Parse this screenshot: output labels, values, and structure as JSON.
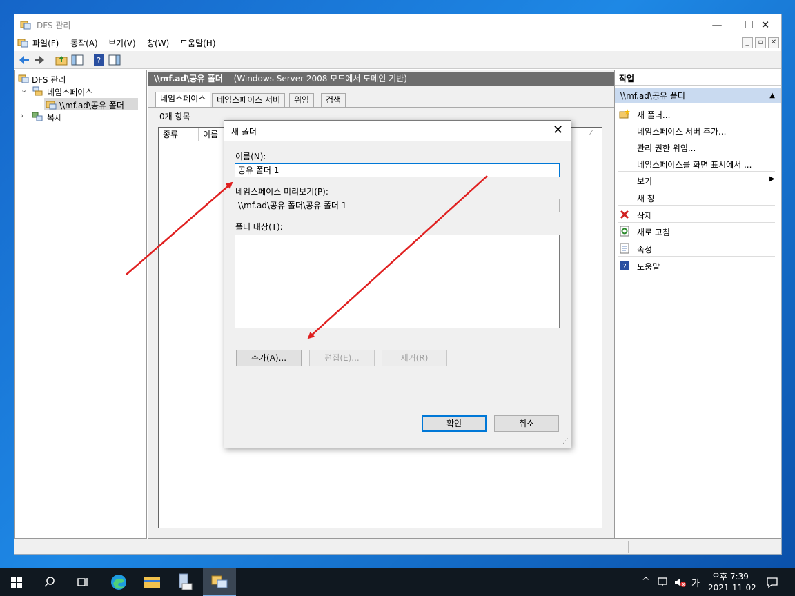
{
  "window": {
    "title": "DFS 관리",
    "menu": [
      "파일(F)",
      "동작(A)",
      "보기(V)",
      "창(W)",
      "도움말(H)"
    ]
  },
  "tree": {
    "root": "DFS 관리",
    "namespaces": "네임스페이스",
    "namespace_item": "\\\\mf.ad\\공유 폴더",
    "replication": "복제"
  },
  "center": {
    "header_path": "\\\\mf.ad\\공유 폴더",
    "header_mode": "(Windows Server 2008 모드에서 도메인 기반)",
    "tabs": [
      "네임스페이스",
      "네임스페이스 서버",
      "위임",
      "검색"
    ],
    "item_count": "0개 항목",
    "columns": [
      "종류",
      "이름"
    ]
  },
  "actions": {
    "header": "작업",
    "section": "\\\\mf.ad\\공유 폴더",
    "items": [
      "새 폴더...",
      "네임스페이스 서버 추가...",
      "관리 권한 위임...",
      "네임스페이스를 화면 표시에서 ...",
      "보기",
      "새 창",
      "삭제",
      "새로 고침",
      "속성",
      "도움말"
    ]
  },
  "dialog": {
    "title": "새 폴더",
    "name_label": "이름(N):",
    "name_value": "공유 폴더 1",
    "preview_label": "네임스페이스 미리보기(P):",
    "preview_value": "\\\\mf.ad\\공유 폴더\\공유 폴더 1",
    "targets_label": "폴더 대상(T):",
    "add_button": "추가(A)...",
    "edit_button": "편집(E)...",
    "remove_button": "제거(R)",
    "ok_button": "확인",
    "cancel_button": "취소"
  },
  "taskbar": {
    "time": "오후 7:39",
    "date": "2021-11-02",
    "ime": "가"
  },
  "colors": {
    "accent": "#0078d7",
    "annotation_arrow": "#e02020",
    "header_bg": "#6d6d6d",
    "selection_bg": "#c9daf0"
  }
}
